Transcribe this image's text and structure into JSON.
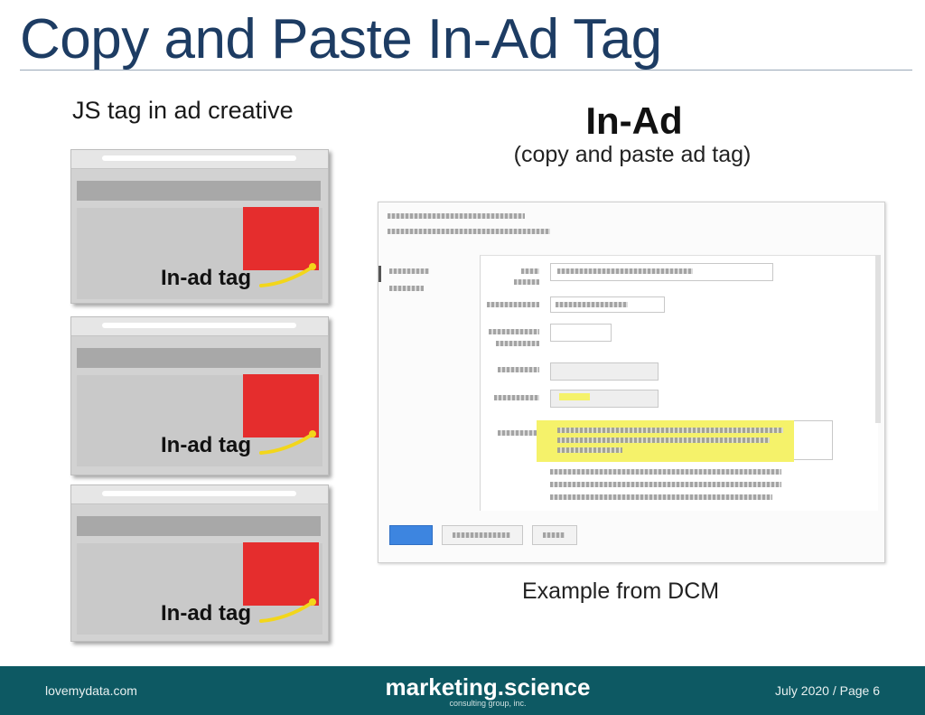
{
  "title": "Copy and Paste In-Ad Tag",
  "left_caption": "JS tag in ad creative",
  "browsers": [
    {
      "tag_label": "In-ad tag"
    },
    {
      "tag_label": "In-ad tag"
    },
    {
      "tag_label": "In-ad tag"
    }
  ],
  "right": {
    "title": "In-Ad",
    "subtitle": "(copy and paste ad tag)",
    "caption": "Example from DCM"
  },
  "footer": {
    "left": "lovemydata.com",
    "center": "marketing.science",
    "center_sub": "consulting group, inc.",
    "right": "July 2020 / Page 6"
  },
  "colors": {
    "title": "#1d3c63",
    "ad_red": "#e52d2d",
    "highlight": "#f5f26a",
    "footer_bg": "#0d5963",
    "pointer": "#f2d61b"
  }
}
